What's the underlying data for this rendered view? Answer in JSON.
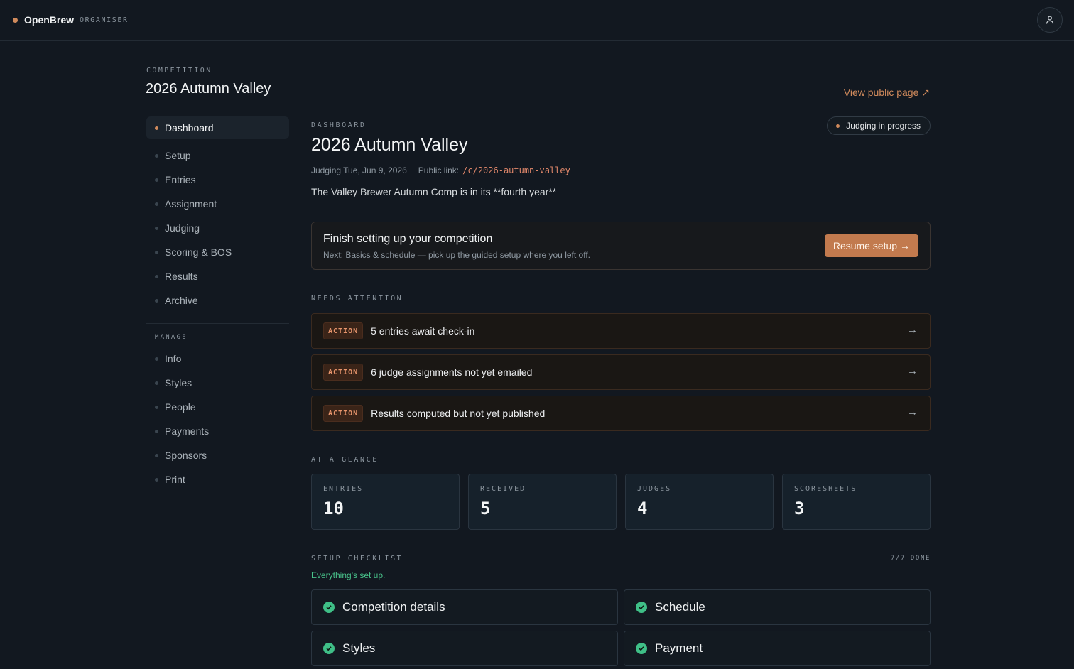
{
  "brand": {
    "name": "OpenBrew",
    "role": "ORGANISER"
  },
  "competition": {
    "eyebrow": "COMPETITION",
    "title": "2026 Autumn Valley"
  },
  "view_public_label": "View public page ↗",
  "sidebar": {
    "items": [
      {
        "label": "Dashboard",
        "active": true
      },
      {
        "label": "Setup"
      },
      {
        "label": "Entries"
      },
      {
        "label": "Assignment"
      },
      {
        "label": "Judging"
      },
      {
        "label": "Scoring & BOS"
      },
      {
        "label": "Results"
      },
      {
        "label": "Archive"
      }
    ],
    "manage_heading": "MANAGE",
    "manage_items": [
      {
        "label": "Info"
      },
      {
        "label": "Styles"
      },
      {
        "label": "People"
      },
      {
        "label": "Payments"
      },
      {
        "label": "Sponsors"
      },
      {
        "label": "Print"
      }
    ]
  },
  "main": {
    "eyebrow": "DASHBOARD",
    "title": "2026 Autumn Valley",
    "status": "Judging in progress",
    "judging_date": "Judging Tue, Jun 9, 2026",
    "public_link_label": "Public link:",
    "public_link": "/c/2026-autumn-valley",
    "description": "The Valley Brewer Autumn Comp is in its **fourth year**",
    "setup_card": {
      "title": "Finish setting up your competition",
      "subtitle": "Next: Basics & schedule — pick up the guided setup where you left off.",
      "button": "Resume setup →"
    },
    "attention": {
      "heading": "NEEDS ATTENTION",
      "items": [
        {
          "tag": "ACTION",
          "text": "5 entries await check-in",
          "arrow": "→"
        },
        {
          "tag": "ACTION",
          "text": "6 judge assignments not yet emailed",
          "arrow": "→"
        },
        {
          "tag": "ACTION",
          "text": "Results computed but not yet published",
          "arrow": "→"
        }
      ]
    },
    "glance": {
      "heading": "AT A GLANCE",
      "stats": [
        {
          "label": "ENTRIES",
          "value": "10"
        },
        {
          "label": "RECEIVED",
          "value": "5"
        },
        {
          "label": "JUDGES",
          "value": "4"
        },
        {
          "label": "SCORESHEETS",
          "value": "3"
        }
      ]
    },
    "checklist": {
      "heading": "SETUP CHECKLIST",
      "progress": "7/7 DONE",
      "status": "Everything's set up.",
      "items": [
        {
          "label": "Competition details"
        },
        {
          "label": "Schedule"
        },
        {
          "label": "Styles"
        },
        {
          "label": "Payment"
        }
      ]
    }
  },
  "colors": {
    "accent": "#d08a5c",
    "success": "#3fbf87",
    "background": "#121820"
  },
  "icons": {
    "user": "user-icon",
    "check": "check-circle-icon",
    "arrow": "arrow-right-icon"
  }
}
